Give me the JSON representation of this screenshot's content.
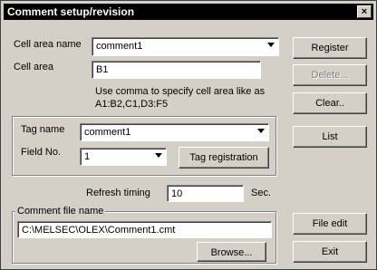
{
  "window": {
    "title": "Comment setup/revision",
    "close_label": "×"
  },
  "cell_area_name": {
    "label": "Cell area name",
    "value": "comment1"
  },
  "cell_area": {
    "label": "Cell area",
    "value": "B1",
    "hint_line1": "Use comma to specify cell area like as",
    "hint_line2": "A1:B2,C1,D3:F5"
  },
  "tag": {
    "name_label": "Tag name",
    "name_value": "comment1",
    "field_label": "Field No.",
    "field_value": "1",
    "registration_button": "Tag registration"
  },
  "refresh": {
    "label": "Refresh timing",
    "value": "10",
    "unit": "Sec."
  },
  "comment_file": {
    "group_label": "Comment file name",
    "path": "C:\\MELSEC\\OLEX\\Comment1.cmt",
    "browse_button": "Browse..."
  },
  "buttons": {
    "register": "Register",
    "delete": "Delete...",
    "clear": "Clear..",
    "list": "List",
    "file_edit": "File edit",
    "exit": "Exit"
  }
}
